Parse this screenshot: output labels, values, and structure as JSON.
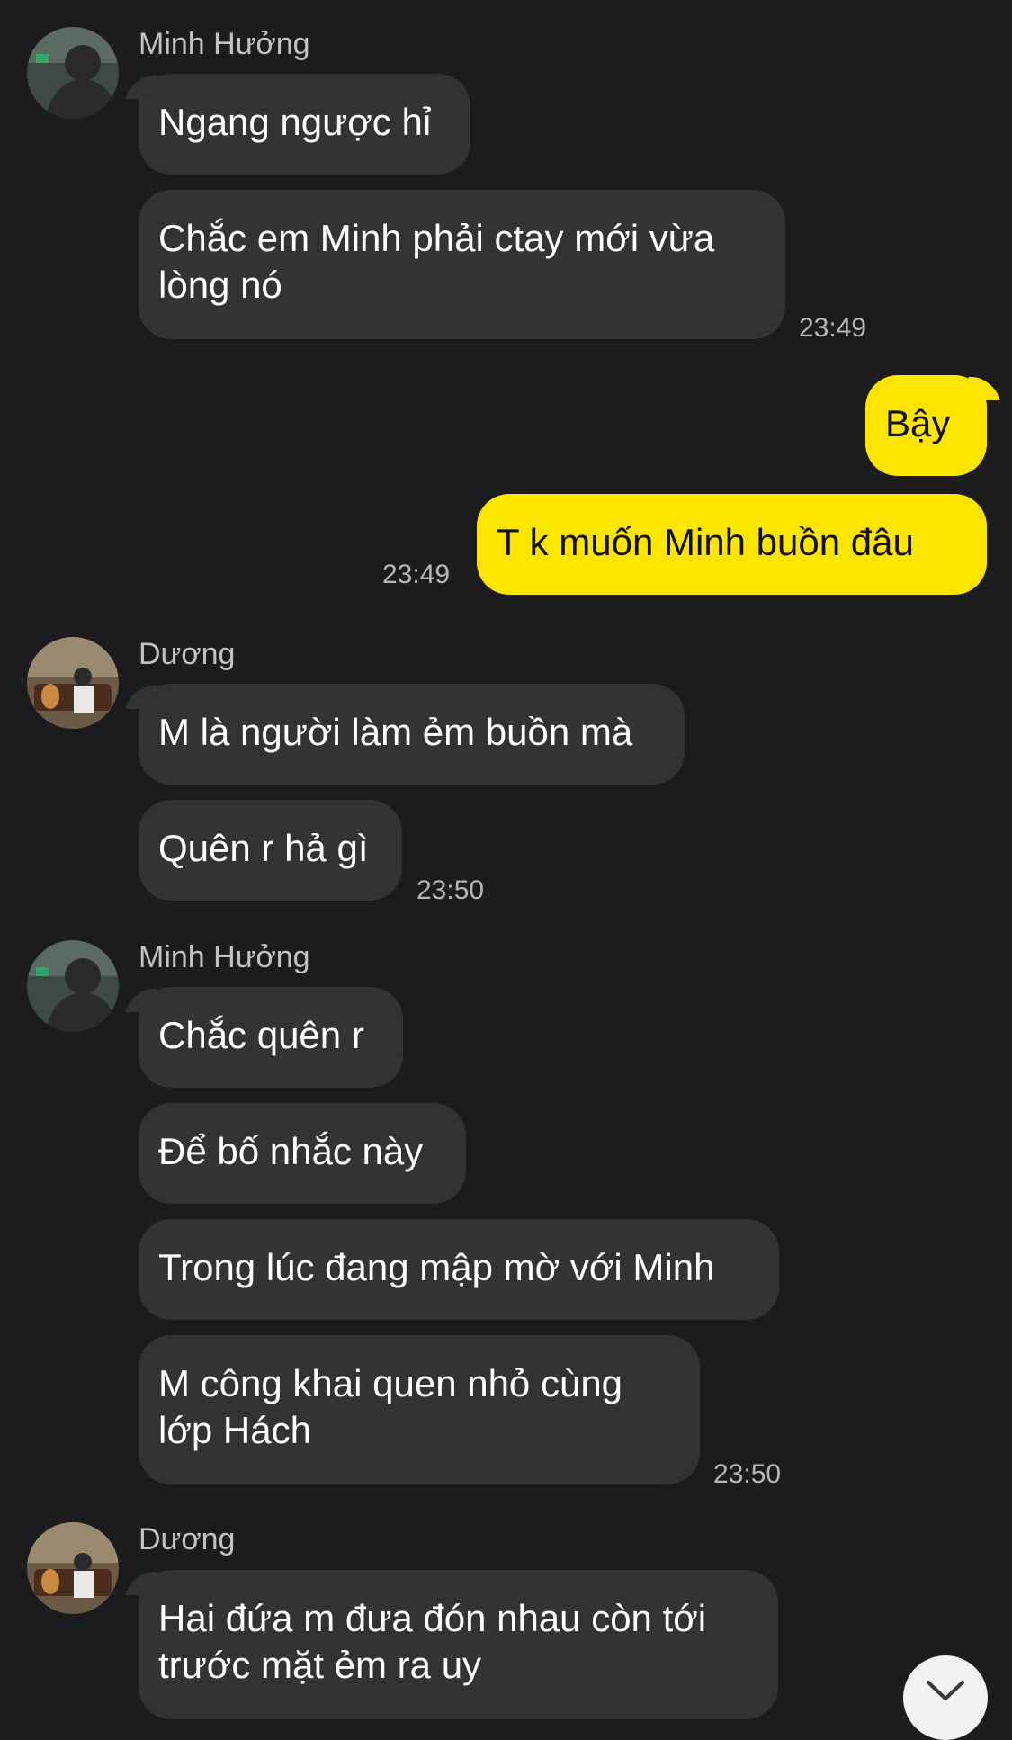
{
  "messages": [
    {
      "sender": "Minh Hưởng",
      "bubbles": [
        "Ngang ngược hỉ",
        "Chắc em Minh phải ctay mới vừa\nlòng nó"
      ],
      "time": "23:49"
    },
    {
      "outgoing": true,
      "bubbles": [
        "Bậy",
        "T k muốn Minh buồn đâu"
      ],
      "time": "23:49"
    },
    {
      "sender": "Dương",
      "bubbles": [
        "M là người làm ẻm buồn mà",
        "Quên r hả gì"
      ],
      "time": "23:50"
    },
    {
      "sender": "Minh Hưởng",
      "bubbles": [
        "Chắc quên r",
        "Để bố nhắc này",
        "Trong lúc đang mập mờ với Minh",
        "M công khai quen nhỏ cùng\nlớp Hách"
      ],
      "time": "23:50"
    },
    {
      "sender": "Dương",
      "bubbles": [
        "Hai đứa m đưa đón nhau còn tới\ntrước mặt ẻm ra uy"
      ]
    }
  ],
  "colors": {
    "background": "#1c1c1e",
    "incoming_bubble": "#333336",
    "outgoing_bubble": "#fee500",
    "timestamp": "#b6b6b8"
  },
  "icons": {
    "scroll_down": "chevron-down-icon"
  }
}
